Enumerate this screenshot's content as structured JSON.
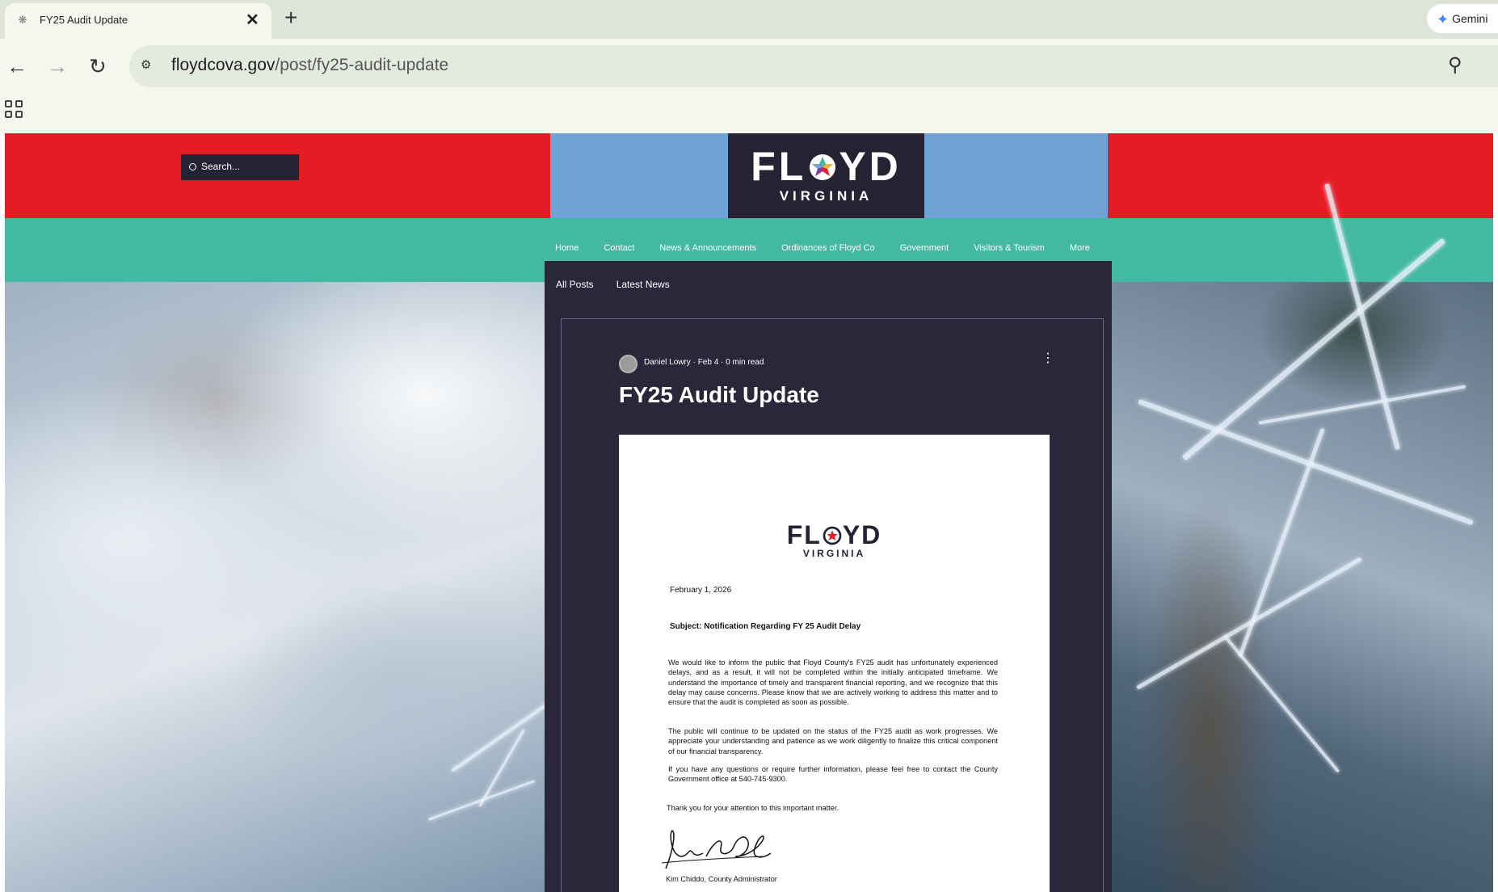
{
  "browser": {
    "tab_title": "FY25 Audit Update",
    "gemini_label": "Gemini",
    "url_domain": "floydcova.gov",
    "url_path": "/post/fy25-audit-update"
  },
  "site": {
    "colors": {
      "header_red": "#e41c23",
      "header_blue": "#6fa3d6",
      "navy": "#262233",
      "nav_teal": "#43b8a2"
    },
    "search_placeholder": "Search...",
    "logo_word_left": "FL",
    "logo_word_right": "YD",
    "logo_sub": "VIRGINIA",
    "nav": [
      "Home",
      "Contact",
      "News & Announcements",
      "Ordinances of Floyd Co",
      "Government",
      "Visitors & Tourism",
      "More"
    ],
    "subnav": [
      "All Posts",
      "Latest News"
    ]
  },
  "post": {
    "meta": "Daniel Lowry · Feb 4 · 0 min read",
    "title": "FY25 Audit Update",
    "letter": {
      "logo_word_left": "FL",
      "logo_word_right": "YD",
      "logo_sub": "VIRGINIA",
      "date": "February 1, 2026",
      "subject": "Subject: Notification Regarding FY 25 Audit Delay",
      "paragraphs": [
        "We would like to inform the public that Floyd County's FY25 audit has unfortunately experienced delays, and as a result, it will not be completed within the initially anticipated timeframe. We understand the importance of timely and transparent financial reporting, and we recognize that this delay may cause concerns. Please know that we are actively working to address this matter and to ensure that the audit is completed as soon as possible.",
        "The public will continue to be updated on the status of the FY25 audit as work progresses. We appreciate your understanding and patience as we work diligently to finalize this critical component of our financial transparency.",
        "If you have any questions or require further information, please feel free to contact the County Government office at 540-745-9300."
      ],
      "thanks": "Thank you for your attention to this important matter.",
      "signer": "Kim Chiddo, County Administrator"
    }
  },
  "icons": [
    "globe-icon",
    "close-icon",
    "plus-icon",
    "gemini-icon",
    "back-arrow-icon",
    "forward-arrow-icon",
    "reload-icon",
    "site-settings-icon",
    "zoom-icon",
    "apps-grid-icon",
    "search-icon",
    "more-vertical-icon"
  ]
}
